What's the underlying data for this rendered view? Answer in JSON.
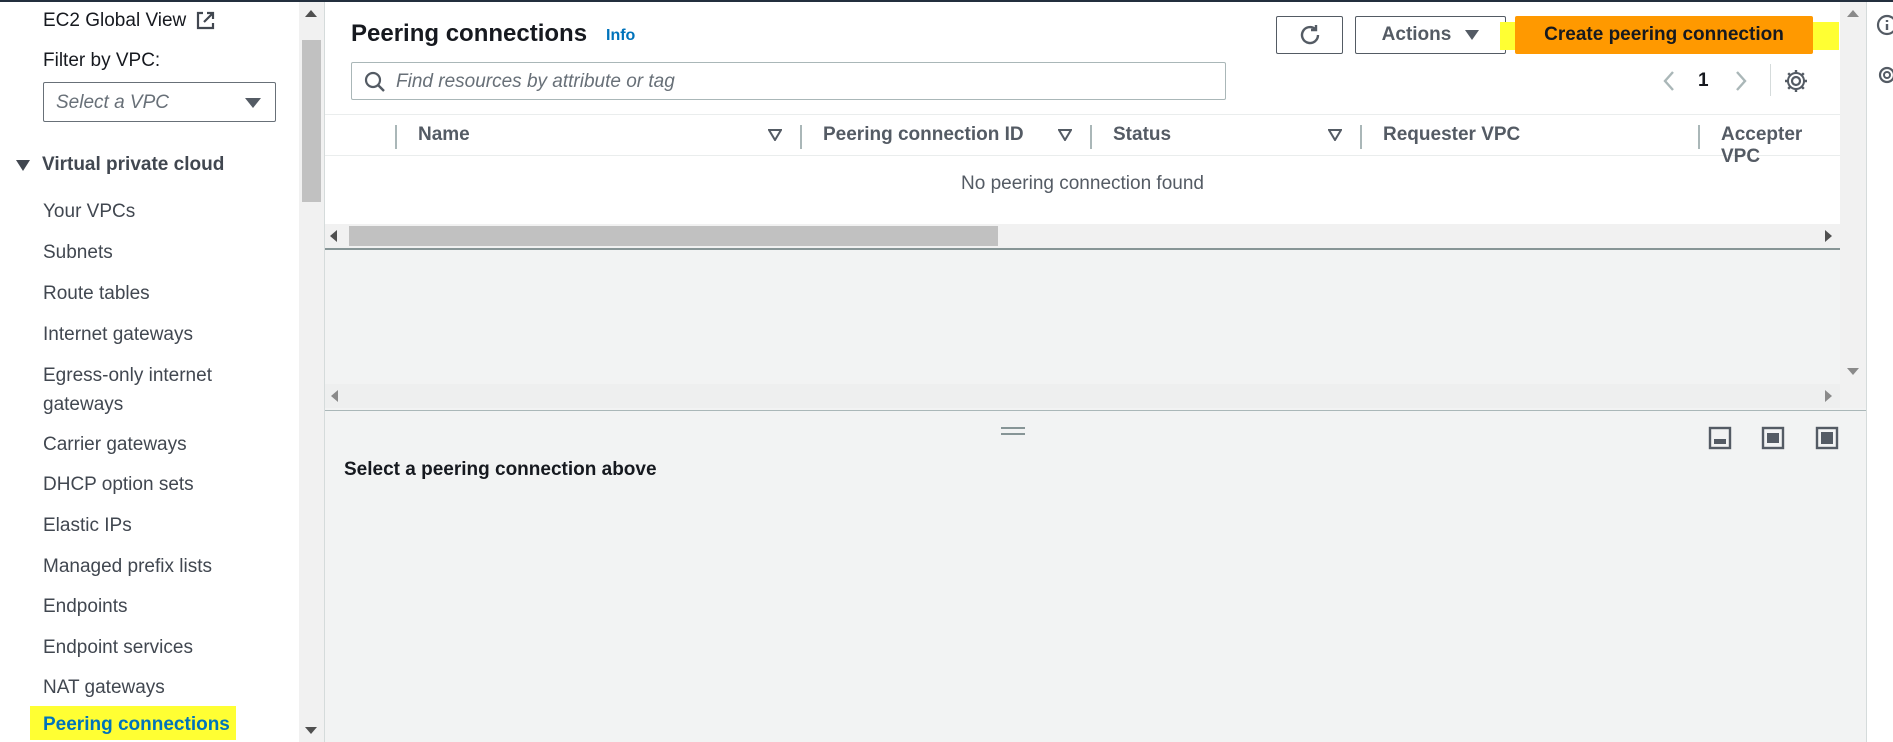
{
  "sidebar": {
    "ec2_global_view": "EC2 Global View",
    "filter_label": "Filter by VPC:",
    "vpc_select_placeholder": "Select a VPC",
    "section_title": "Virtual private cloud",
    "items": [
      {
        "label": "Your VPCs"
      },
      {
        "label": "Subnets"
      },
      {
        "label": "Route tables"
      },
      {
        "label": "Internet gateways"
      },
      {
        "label": "Egress-only internet"
      },
      {
        "label": "gateways"
      },
      {
        "label": "Carrier gateways"
      },
      {
        "label": "DHCP option sets"
      },
      {
        "label": "Elastic IPs"
      },
      {
        "label": "Managed prefix lists"
      },
      {
        "label": "Endpoints"
      },
      {
        "label": "Endpoint services"
      },
      {
        "label": "NAT gateways"
      },
      {
        "label": "Peering connections"
      }
    ]
  },
  "header": {
    "title": "Peering connections",
    "info_link": "Info",
    "actions_label": "Actions",
    "create_label": "Create peering connection"
  },
  "search": {
    "placeholder": "Find resources by attribute or tag",
    "value": ""
  },
  "pagination": {
    "current_page": "1"
  },
  "table": {
    "columns": [
      "Name",
      "Peering connection ID",
      "Status",
      "Requester VPC",
      "Accepter VPC"
    ],
    "empty_message": "No peering connection found"
  },
  "details": {
    "message": "Select a peering connection above"
  },
  "colors": {
    "primary_button": "#ff9900",
    "link": "#0073bb",
    "highlight": "#ffff33"
  },
  "icons": [
    "external-link-icon",
    "search-icon",
    "refresh-icon",
    "settings-icon",
    "chevron-left-icon",
    "chevron-right-icon",
    "split-bottom-icon",
    "split-side-icon",
    "fullscreen-icon",
    "info-icon",
    "gear-icon"
  ]
}
